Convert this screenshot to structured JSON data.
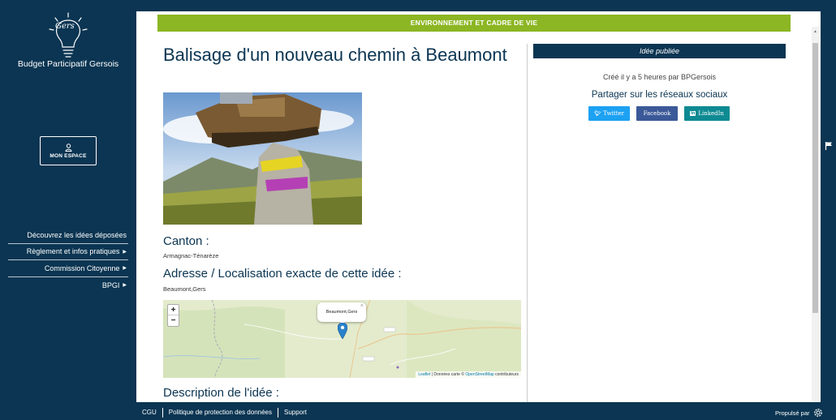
{
  "site": {
    "name": "Budget Participatif Gersois",
    "logo_text": "Gers"
  },
  "sidebar": {
    "account_button": "MON ESPACE",
    "nav": [
      {
        "label": "Découvrez les idées déposées",
        "has_caret": false
      },
      {
        "label": "Règlement et infos pratiques",
        "has_caret": true
      },
      {
        "label": "Commission Citoyenne",
        "has_caret": true
      },
      {
        "label": "BPGI",
        "has_caret": true
      }
    ]
  },
  "idea": {
    "category": "ENVIRONNEMENT ET CADRE DE VIE",
    "title": "Balisage d'un nouveau chemin à Beaumont",
    "canton_heading": "Canton :",
    "canton_value": "Armagnac-Ténarèze",
    "address_heading": "Adresse / Localisation exacte de cette idée :",
    "address_value": "Beaumont,Gers",
    "description_heading": "Description de l'idée :"
  },
  "map": {
    "zoom_in": "+",
    "zoom_out": "−",
    "popup_label": "Beaumont,Gers",
    "popup_close": "×",
    "attribution_leaflet": "Leaflet",
    "attribution_sep": " | Données carte © ",
    "attribution_osm": "OpenStreetMap",
    "attribution_end": " contributeurs"
  },
  "status": {
    "label": "Idée publiée",
    "created": "Créé il y a 5 heures par BPGersois",
    "share_heading": "Partager sur les réseaux sociaux",
    "share": [
      {
        "label": "Twitter",
        "icon": "twitter-icon"
      },
      {
        "label": "Facebook",
        "icon": "facebook-icon"
      },
      {
        "label": "LinkedIn",
        "icon": "linkedin-icon"
      }
    ]
  },
  "footer": {
    "links": [
      "CGU",
      "Politique de protection des données",
      "Support"
    ],
    "powered_by": "Propulsé par"
  },
  "colors": {
    "navy": "#0b3552",
    "category_green": "#8cb623",
    "twitter": "#1da1f2",
    "facebook": "#3b5998",
    "linkedin": "#0e8a93"
  }
}
